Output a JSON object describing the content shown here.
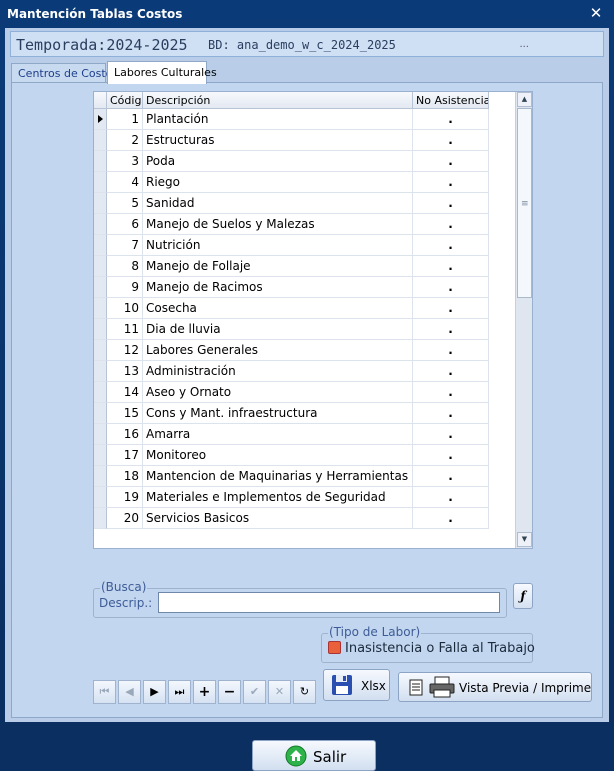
{
  "window": {
    "title": "Mantención Tablas Costos",
    "close_glyph": "✕"
  },
  "header": {
    "season_label": "Temporada:",
    "season_value": "2024-2025",
    "bd_label": "BD:",
    "bd_value": "ana_demo_w_c_2024_2025",
    "dots": "..."
  },
  "tabs": [
    {
      "label": "Centros de Costo",
      "active": false
    },
    {
      "label": "Labores Culturales",
      "active": true
    }
  ],
  "grid": {
    "columns": [
      "Código",
      "Descripción",
      "No Asistencia"
    ],
    "rows": [
      {
        "code": "1",
        "desc": "Plantación",
        "na": "."
      },
      {
        "code": "2",
        "desc": "Estructuras",
        "na": "."
      },
      {
        "code": "3",
        "desc": "Poda",
        "na": "."
      },
      {
        "code": "4",
        "desc": "Riego",
        "na": "."
      },
      {
        "code": "5",
        "desc": "Sanidad",
        "na": "."
      },
      {
        "code": "6",
        "desc": "Manejo de Suelos y Malezas",
        "na": "."
      },
      {
        "code": "7",
        "desc": "Nutrición",
        "na": "."
      },
      {
        "code": "8",
        "desc": "Manejo de Follaje",
        "na": "."
      },
      {
        "code": "9",
        "desc": "Manejo de Racimos",
        "na": "."
      },
      {
        "code": "10",
        "desc": "Cosecha",
        "na": "."
      },
      {
        "code": "11",
        "desc": "Dia de lluvia",
        "na": "."
      },
      {
        "code": "12",
        "desc": "Labores Generales",
        "na": "."
      },
      {
        "code": "13",
        "desc": "Administración",
        "na": "."
      },
      {
        "code": "14",
        "desc": "Aseo y Ornato",
        "na": "."
      },
      {
        "code": "15",
        "desc": "Cons y Mant. infraestructura",
        "na": "."
      },
      {
        "code": "16",
        "desc": "Amarra",
        "na": "."
      },
      {
        "code": "17",
        "desc": "Monitoreo",
        "na": "."
      },
      {
        "code": "18",
        "desc": "Mantencion de Maquinarias y Herramientas",
        "na": "."
      },
      {
        "code": "19",
        "desc": "Materiales e Implementos de Seguridad",
        "na": "."
      },
      {
        "code": "20",
        "desc": "Servicios Basicos",
        "na": "."
      }
    ]
  },
  "search": {
    "legend": "(Busca)",
    "label": "Descrip.:",
    "value": ""
  },
  "fx_button": {
    "label": "ƒ"
  },
  "tipo_labor": {
    "legend": "(Tipo de Labor)",
    "option": "Inasistencia o Falla al Trabajo",
    "swatch_color": "#e8613a"
  },
  "nav": {
    "first": "⏮",
    "prev": "◀",
    "next": "▶",
    "last": "⏭",
    "add": "+",
    "remove": "−",
    "confirm": "✔",
    "cancel": "✕",
    "refresh": "↻"
  },
  "xlsx_button": {
    "label": "Xlsx"
  },
  "print_button": {
    "label": "Vista Previa / Imprime"
  },
  "exit_button": {
    "label": "Salir"
  }
}
